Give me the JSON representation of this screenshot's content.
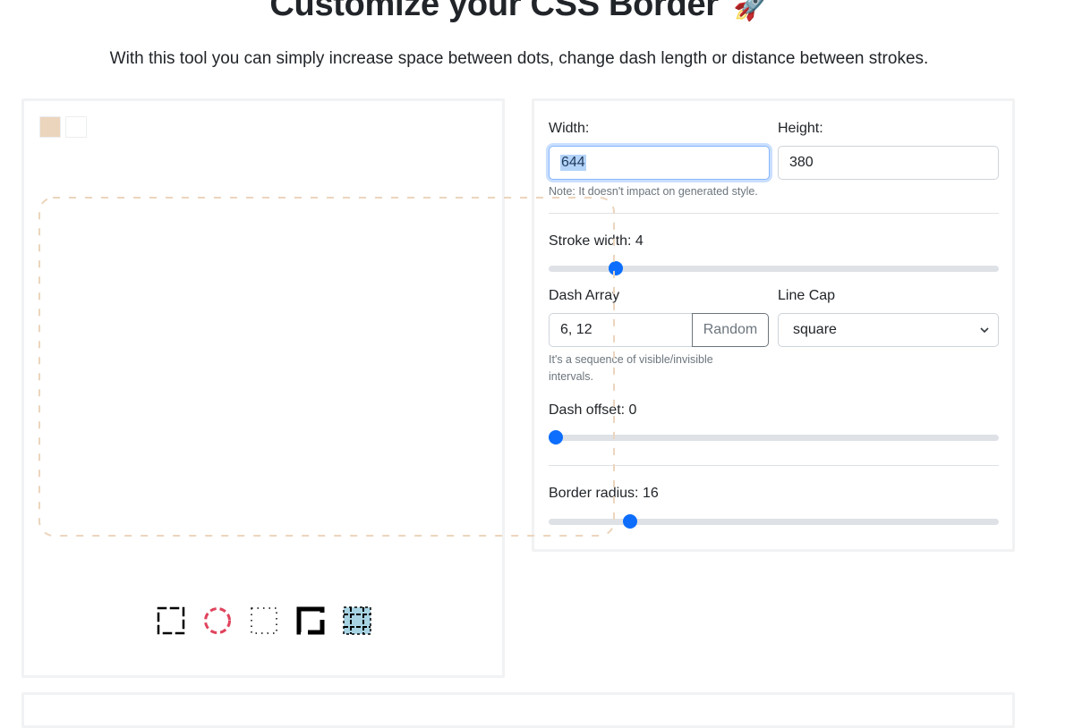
{
  "header": {
    "title": "Customize your CSS Border",
    "title_emoji": "🚀",
    "subtitle": "With this tool you can simply increase space between dots, change dash length or distance between strokes."
  },
  "preview": {
    "colors": [
      "#ecd5bd",
      "#ffffff"
    ],
    "border_color": "#ecd5bd",
    "presets": [
      {
        "name": "dashed-square-preset-icon",
        "color": "#000000"
      },
      {
        "name": "dashed-circle-preset-icon",
        "color": "#e0435c"
      },
      {
        "name": "dotted-square-preset-icon",
        "color": "#000000"
      },
      {
        "name": "thick-dashed-square-preset-icon",
        "color": "#000000"
      },
      {
        "name": "grid-pattern-preset-icon",
        "color": "#000000",
        "fill": "#a8d3e3"
      }
    ]
  },
  "settings": {
    "width_label": "Width:",
    "width_value": "644",
    "height_label": "Height:",
    "height_value": "380",
    "size_note": "Note: It doesn't impact on generated style.",
    "stroke_label": "Stroke width: 4",
    "stroke_value": 4,
    "stroke_fraction": 0.137,
    "dash_array_label": "Dash Array",
    "dash_array_value": "6, 12",
    "random_label": "Random",
    "line_cap_label": "Line Cap",
    "line_cap_value": "square",
    "dash_note": "It's a sequence of visible/invisible intervals.",
    "dash_offset_label": "Dash offset: 0",
    "dash_offset_value": 0,
    "dash_offset_fraction": 0.0,
    "radius_label": "Border radius: 16",
    "radius_value": 16,
    "radius_fraction": 0.17,
    "accent_color": "#0d6efd"
  }
}
